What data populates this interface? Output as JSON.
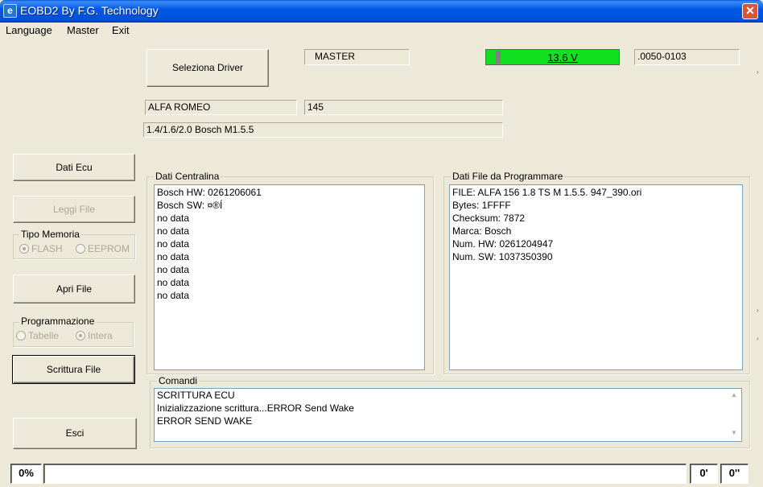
{
  "window": {
    "title": "EOBD2 By F.G. Technology",
    "icon": "app-icon",
    "close": "close-icon"
  },
  "menu": {
    "language": "Language",
    "master": "Master",
    "exit": "Exit"
  },
  "top": {
    "select_driver": "Seleziona Driver",
    "mode": "MASTER",
    "voltage": "13.6 V",
    "version": ".0050-0103",
    "make": "ALFA ROMEO",
    "model": "145",
    "engine": "1.4/1.6/2.0  Bosch M1.5.5"
  },
  "left": {
    "dati_ecu": "Dati Ecu",
    "leggi_file": "Leggi File",
    "tipo_memoria": "Tipo Memoria",
    "flash": "FLASH",
    "eeprom": "EEPROM",
    "apri_file": "Apri File",
    "programmazione": "Programmazione",
    "tabelle": "Tabelle",
    "intera": "Intera",
    "scrittura_file": "Scrittura File",
    "esci": "Esci"
  },
  "dati_centralina": {
    "label": "Dati Centralina",
    "lines": [
      "Bosch HW: 0261206061",
      "Bosch SW: ¤®Í",
      "no data",
      "no data",
      "no data",
      "no data",
      "no data",
      "no data",
      "no data"
    ]
  },
  "dati_file": {
    "label": "Dati File da Programmare",
    "lines": [
      "FILE: ALFA 156 1.8 TS  M 1.5.5. 947_390.ori",
      "Bytes: 1FFFF",
      "Checksum: 7872",
      "Marca: Bosch",
      "Num. HW: 0261204947",
      "Num. SW: 1037350390"
    ]
  },
  "comandi": {
    "label": "Comandi",
    "lines": [
      "SCRITTURA ECU",
      "Inizializzazione scrittura...ERROR Send Wake",
      "ERROR SEND WAKE"
    ]
  },
  "status": {
    "percent": "0%",
    "minutes": "0'",
    "seconds": "0''"
  },
  "colors": {
    "titlebar": "#0054e3",
    "battery_ok": "#10e020",
    "window_bg": "#ece9d8"
  }
}
